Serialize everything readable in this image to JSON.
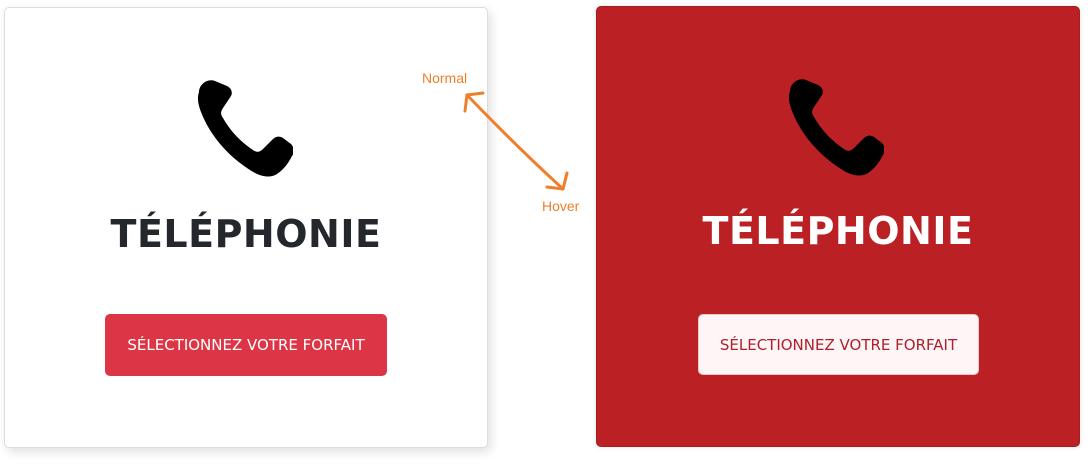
{
  "cards": {
    "normal": {
      "icon": "phone-icon",
      "title": "TÉLÉPHONIE",
      "button_label": "SÉLECTIONNEZ VOTRE FORFAIT"
    },
    "hover": {
      "icon": "phone-icon",
      "title": "TÉLÉPHONIE",
      "button_label": "SÉLECTIONNEZ VOTRE FORFAIT"
    }
  },
  "annotations": {
    "normal_label": "Normal",
    "hover_label": "Hover",
    "arrow": "double-headed-arrow-icon"
  },
  "colors": {
    "card_normal_bg": "#ffffff",
    "card_hover_bg": "#bb2124",
    "button_normal_bg": "#dc3545",
    "button_hover_bg": "#fdf5f6",
    "title_dark": "#24282d",
    "annotation": "#ef7f2a"
  }
}
